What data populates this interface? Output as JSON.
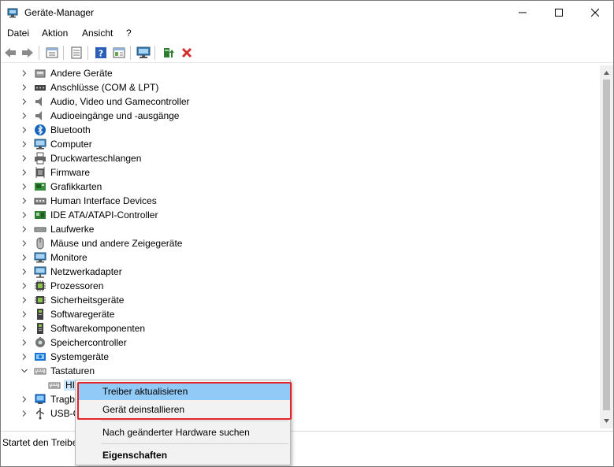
{
  "window": {
    "title": "Geräte-Manager",
    "accent_color": "#0078d7"
  },
  "menu": [
    {
      "label": "Datei"
    },
    {
      "label": "Aktion"
    },
    {
      "label": "Ansicht"
    },
    {
      "label": "?"
    }
  ],
  "toolbar": {
    "buttons": [
      "back-icon",
      "forward-icon",
      "properties-icon",
      "show-hide-icon",
      "help-icon",
      "view-icon",
      "monitor-icon",
      "update-driver-icon",
      "uninstall-icon"
    ]
  },
  "tree": {
    "categories": [
      {
        "label": "Andere Geräte",
        "icon": "other-devices-icon"
      },
      {
        "label": "Anschlüsse (COM & LPT)",
        "icon": "port-icon"
      },
      {
        "label": "Audio, Video und Gamecontroller",
        "icon": "speaker-icon"
      },
      {
        "label": "Audioeingänge und -ausgänge",
        "icon": "speaker-icon"
      },
      {
        "label": "Bluetooth",
        "icon": "bluetooth-icon"
      },
      {
        "label": "Computer",
        "icon": "computer-icon"
      },
      {
        "label": "Druckwarteschlangen",
        "icon": "printer-icon"
      },
      {
        "label": "Firmware",
        "icon": "firmware-icon"
      },
      {
        "label": "Grafikkarten",
        "icon": "display-adapter-icon"
      },
      {
        "label": "Human Interface Devices",
        "icon": "hid-icon"
      },
      {
        "label": "IDE ATA/ATAPI-Controller",
        "icon": "ide-icon"
      },
      {
        "label": "Laufwerke",
        "icon": "disk-drive-icon"
      },
      {
        "label": "Mäuse und andere Zeigegeräte",
        "icon": "mouse-icon"
      },
      {
        "label": "Monitore",
        "icon": "monitor-icon"
      },
      {
        "label": "Netzwerkadapter",
        "icon": "network-adapter-icon"
      },
      {
        "label": "Prozessoren",
        "icon": "processor-icon"
      },
      {
        "label": "Sicherheitsgeräte",
        "icon": "security-device-icon"
      },
      {
        "label": "Softwaregeräte",
        "icon": "software-device-icon"
      },
      {
        "label": "Softwarekomponenten",
        "icon": "software-component-icon"
      },
      {
        "label": "Speichercontroller",
        "icon": "storage-controller-icon"
      },
      {
        "label": "Systemgeräte",
        "icon": "system-device-icon"
      },
      {
        "label": "Tastaturen",
        "icon": "keyboard-icon",
        "expanded": true
      }
    ],
    "child": {
      "label": "HI",
      "icon": "keyboard-icon"
    },
    "after": [
      {
        "label": "Tragba",
        "icon": "portable-device-icon"
      },
      {
        "label": "USB-C",
        "icon": "usb-icon"
      }
    ]
  },
  "status": {
    "text": "Startet den Treiber"
  },
  "context_menu": {
    "items": [
      {
        "label": "Treiber aktualisieren",
        "highlighted": true
      },
      {
        "label": "Gerät deinstallieren"
      },
      {
        "label": "Nach geänderter Hardware suchen"
      },
      {
        "label": "Eigenschaften",
        "bold": true
      }
    ],
    "highlight_color": "#e3242b"
  }
}
